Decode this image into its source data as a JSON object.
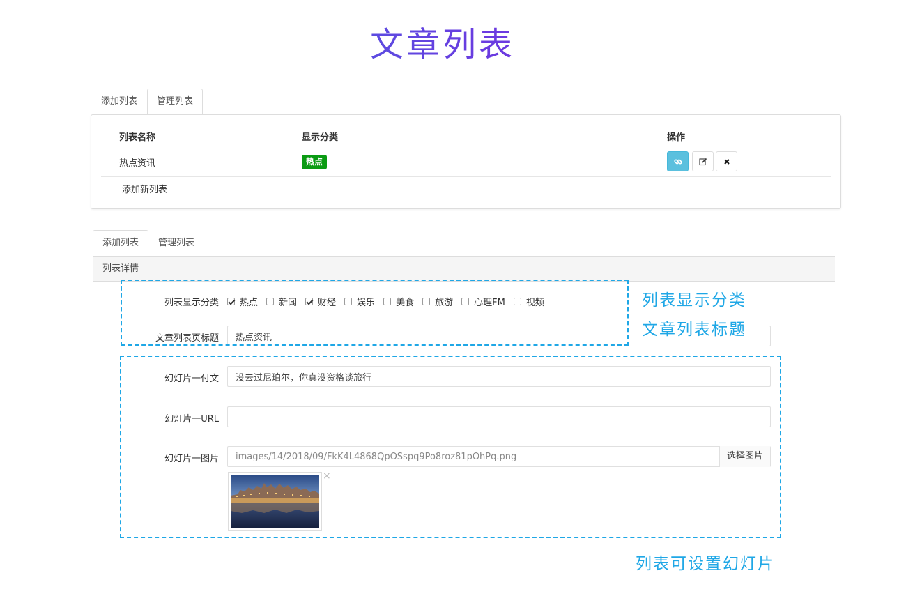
{
  "page_title": "文章列表",
  "top_tabs": {
    "add": "添加列表",
    "manage": "管理列表"
  },
  "table": {
    "headers": {
      "name": "列表名称",
      "category": "显示分类",
      "actions": "操作"
    },
    "rows": [
      {
        "name": "热点资讯",
        "badge": "热点"
      }
    ],
    "add_new": "添加新列表"
  },
  "bottom_tabs": {
    "add": "添加列表",
    "manage": "管理列表"
  },
  "detail": {
    "header": "列表详情",
    "categories_label": "列表显示分类",
    "categories": [
      {
        "label": "热点",
        "checked": true
      },
      {
        "label": "新闻",
        "checked": false
      },
      {
        "label": "财经",
        "checked": true
      },
      {
        "label": "娱乐",
        "checked": false
      },
      {
        "label": "美食",
        "checked": false
      },
      {
        "label": "旅游",
        "checked": false
      },
      {
        "label": "心理FM",
        "checked": false
      },
      {
        "label": "视频",
        "checked": false
      }
    ],
    "page_title_label": "文章列表页标题",
    "page_title_value": "热点资讯",
    "slide_caption_label": "幻灯片一付文",
    "slide_caption_value": "没去过尼珀尔，你真没资格谈旅行",
    "slide_url_label": "幻灯片一URL",
    "slide_url_value": "",
    "slide_image_label": "幻灯片一图片",
    "slide_image_value": "images/14/2018/09/FkK4L4868QpOSspq9Po8roz81pOhPq.png",
    "choose_image": "选择图片",
    "remove_image": "×"
  },
  "annotations": {
    "categories": "列表显示分类",
    "title": "文章列表标题",
    "slides": "列表可设置幻灯片"
  },
  "colors": {
    "accent": "#1fa7e6",
    "badge": "#0a9b13",
    "link_button": "#5bc0de"
  },
  "icons": {
    "link": "link-icon",
    "edit": "edit-icon",
    "delete": "close-icon"
  }
}
